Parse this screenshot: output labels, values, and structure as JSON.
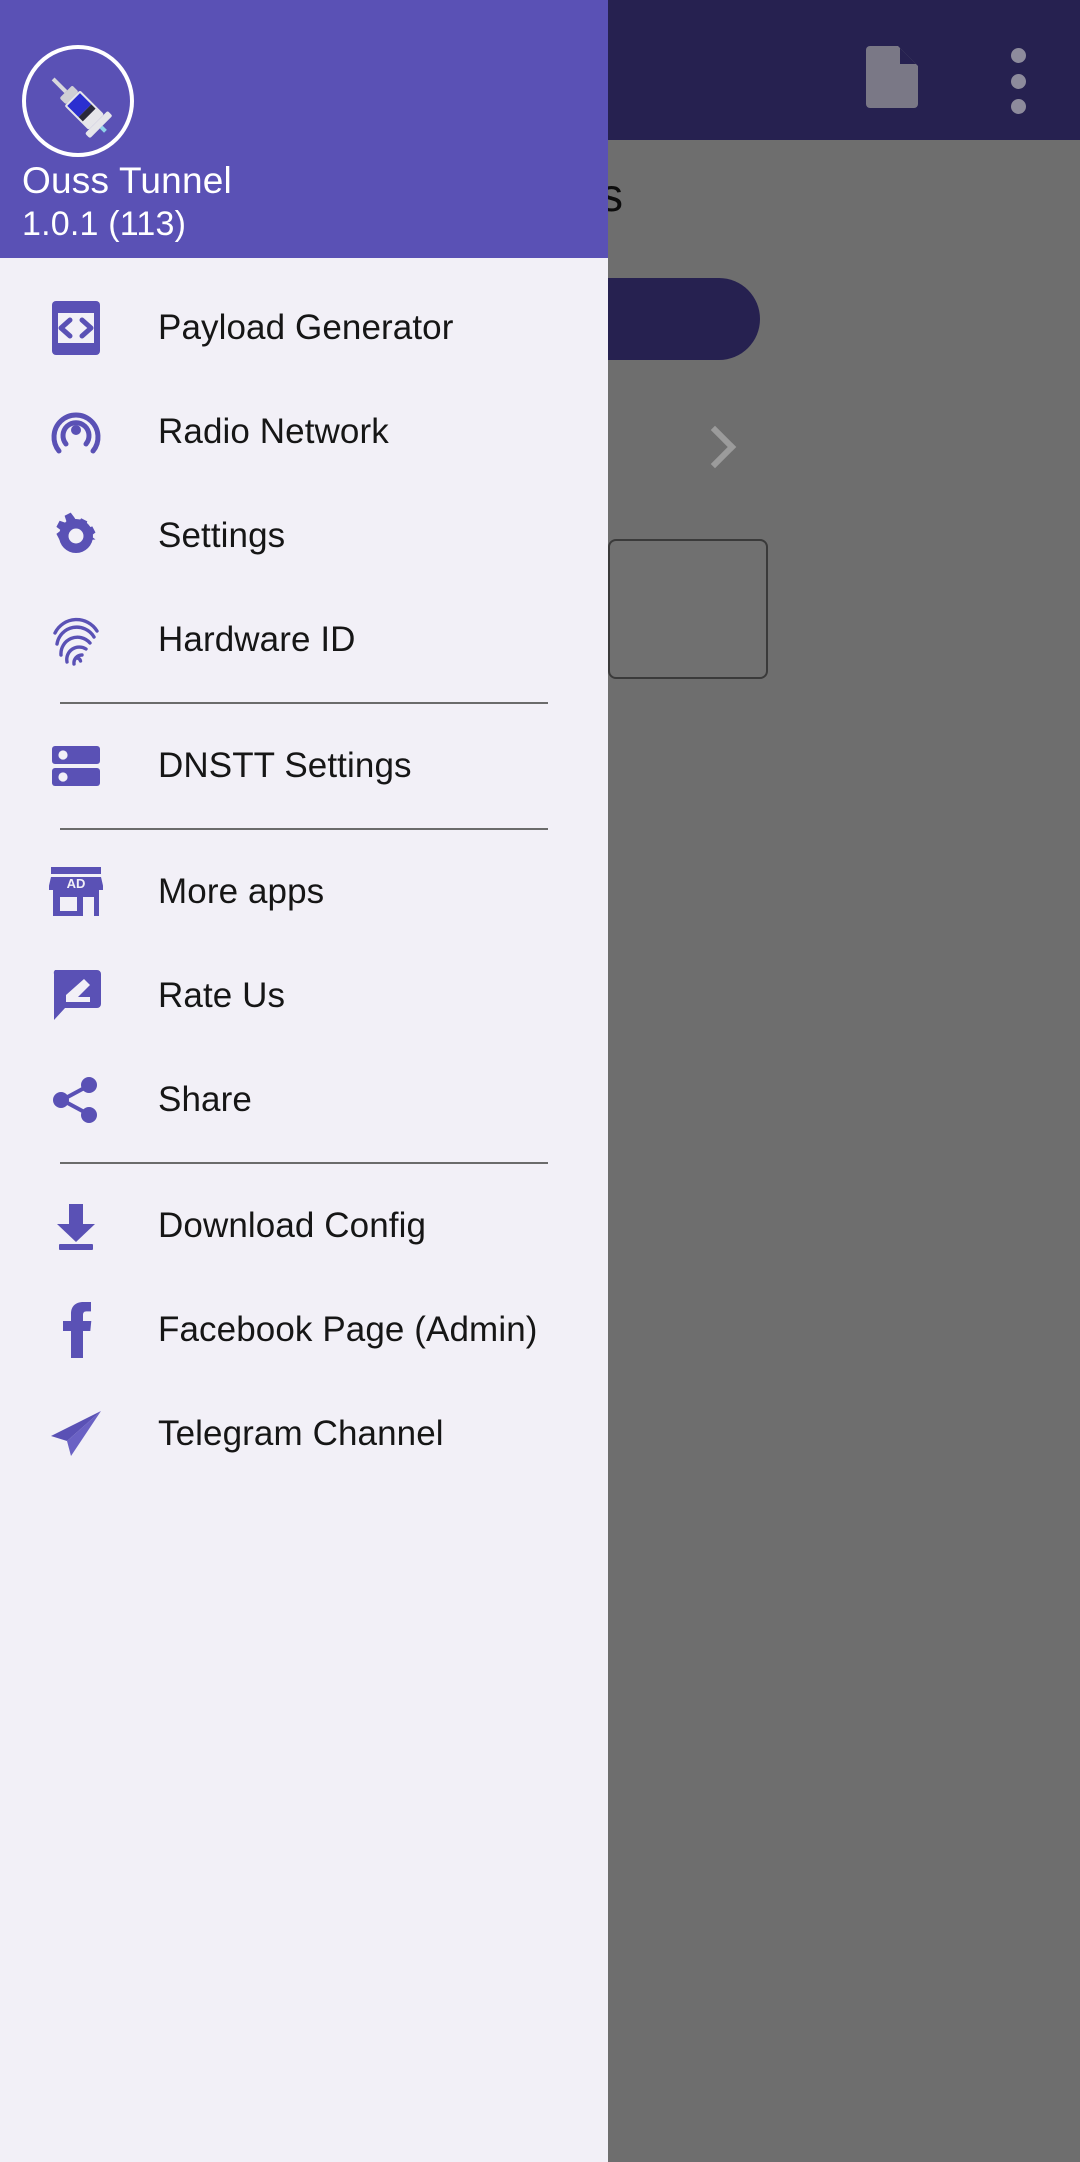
{
  "drawer": {
    "header": {
      "logo_icon": "syringe-icon",
      "app_name": "Ouss Tunnel",
      "version": "1.0.1 (113)",
      "background_color": "#5a51b5"
    },
    "background_color": "#f2f0f7",
    "groups": [
      {
        "items": [
          {
            "label": "Payload Generator",
            "icon": "code-phone-icon"
          },
          {
            "label": "Radio Network",
            "icon": "broadcast-icon"
          },
          {
            "label": "Settings",
            "icon": "gear-icon"
          },
          {
            "label": "Hardware ID",
            "icon": "fingerprint-icon"
          }
        ]
      },
      {
        "items": [
          {
            "label": "DNSTT Settings",
            "icon": "server-icon"
          }
        ]
      },
      {
        "items": [
          {
            "label": "More apps",
            "icon": "store-ad-icon"
          },
          {
            "label": "Rate Us",
            "icon": "review-edit-icon"
          },
          {
            "label": "Share",
            "icon": "share-icon"
          }
        ]
      },
      {
        "items": [
          {
            "label": "Download Config",
            "icon": "download-icon"
          },
          {
            "label": "Facebook Page (Admin)",
            "icon": "facebook-icon"
          },
          {
            "label": "Telegram Channel",
            "icon": "telegram-icon"
          }
        ]
      }
    ]
  },
  "background": {
    "appbar": {
      "background_color": "#262150",
      "file_icon": "file-document-icon",
      "overflow_icon": "overflow-menu-icon"
    },
    "scrim_text": "s",
    "pill_button": {
      "color": "#262150"
    },
    "card": {
      "chevron_icon": "chevron-right-icon"
    },
    "accent_color": "#5a51b5"
  }
}
